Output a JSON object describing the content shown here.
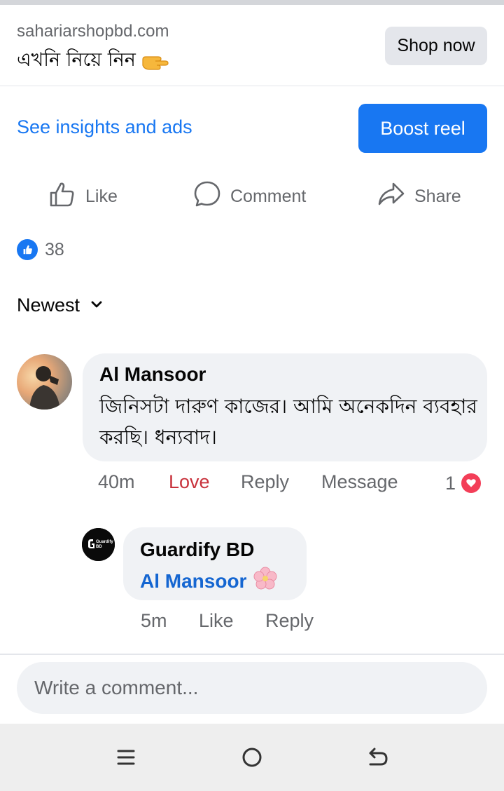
{
  "ad": {
    "domain": "sahariarshopbd.com",
    "headline": "এখনি নিয়ে নিন",
    "shop_button": "Shop now"
  },
  "post_tools": {
    "insights_link": "See insights and ads",
    "boost_button": "Boost reel"
  },
  "actions": {
    "like": "Like",
    "comment": "Comment",
    "share": "Share"
  },
  "reactions": {
    "count": "38"
  },
  "sort": {
    "label": "Newest"
  },
  "comments": [
    {
      "author": "Al Mansoor",
      "text": "জিনিসটা দারুণ কাজের। আমি অনেকদিন ব্যবহার করছি। ধন্যবাদ।",
      "time": "40m",
      "reaction_label": "Love",
      "reply_label": "Reply",
      "message_label": "Message",
      "reaction_count": "1",
      "replies": [
        {
          "author": "Guardify BD",
          "avatar_text": "Guardify BD",
          "mention": "Al Mansoor",
          "time": "5m",
          "like_label": "Like",
          "reply_label": "Reply"
        }
      ]
    }
  ],
  "composer": {
    "placeholder": "Write a comment..."
  },
  "colors": {
    "primary": "#1877f2",
    "love": "#c8323c",
    "secondary_text": "#65676b",
    "bubble": "#f0f2f5"
  }
}
